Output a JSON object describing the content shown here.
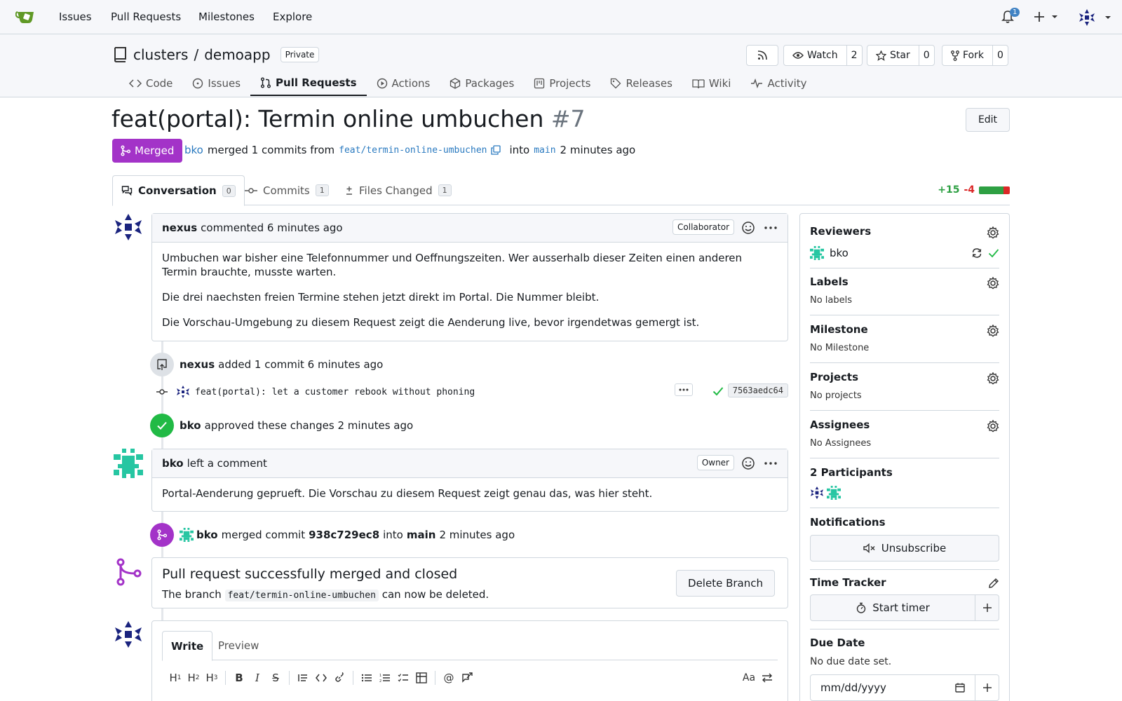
{
  "topnav": {
    "items": [
      "Issues",
      "Pull Requests",
      "Milestones",
      "Explore"
    ],
    "notification_count": "1"
  },
  "repo": {
    "owner": "clusters",
    "separator": "/",
    "name": "demoapp",
    "visibility": "Private",
    "watch_label": "Watch",
    "watch_count": "2",
    "star_label": "Star",
    "star_count": "0",
    "fork_label": "Fork",
    "fork_count": "0",
    "tabs": [
      "Code",
      "Issues",
      "Pull Requests",
      "Actions",
      "Packages",
      "Projects",
      "Releases",
      "Wiki",
      "Activity"
    ]
  },
  "pr": {
    "title": "feat(portal): Termin online umbuchen",
    "number": "#7",
    "edit_label": "Edit",
    "status": "Merged",
    "merger": "bko",
    "merged_text": "merged 1 commits from",
    "head_branch": "feat/termin-online-umbuchen",
    "into_text": "into",
    "base_branch": "main",
    "when": "2 minutes ago",
    "tabs": [
      {
        "label": "Conversation",
        "count": "0"
      },
      {
        "label": "Commits",
        "count": "1"
      },
      {
        "label": "Files Changed",
        "count": "1"
      }
    ],
    "additions": "+15",
    "deletions": "-4"
  },
  "timeline": {
    "comment1": {
      "author": "nexus",
      "action": "commented 6 minutes ago",
      "role": "Collaborator",
      "paragraphs": [
        "Umbuchen war bisher eine Telefonnummer und Oeffnungszeiten. Wer ausserhalb dieser Zeiten einen anderen Termin brauchte, musste warten.",
        "Die drei naechsten freien Termine stehen jetzt direkt im Portal. Die Nummer bleibt.",
        "Die Vorschau-Umgebung zu diesem Request zeigt die Aenderung live, bevor irgendetwas gemergt ist."
      ]
    },
    "commit_event": {
      "author": "nexus",
      "text": "added 1 commit 6 minutes ago"
    },
    "commit": {
      "message": "feat(portal): let a customer rebook without phoning",
      "sha": "7563aedc64"
    },
    "approval": {
      "author": "bko",
      "text": "approved these changes 2 minutes ago"
    },
    "comment2": {
      "author": "bko",
      "action": "left a comment",
      "role": "Owner",
      "body": "Portal-Aenderung geprueft. Die Vorschau zu diesem Request zeigt genau das, was hier steht."
    },
    "merge_event": {
      "author": "bko",
      "text1": "merged commit",
      "sha": "938c729ec8",
      "text2": "into",
      "branch": "main",
      "when": "2 minutes ago"
    },
    "merge_box": {
      "title": "Pull request successfully merged and closed",
      "pre": "The branch",
      "branch": "feat/termin-online-umbuchen",
      "post": "can now be deleted.",
      "button": "Delete Branch"
    },
    "editor": {
      "tab_write": "Write",
      "tab_preview": "Preview",
      "aa": "Aa"
    }
  },
  "sidebar": {
    "reviewers": {
      "title": "Reviewers",
      "name": "bko"
    },
    "labels": {
      "title": "Labels",
      "value": "No labels"
    },
    "milestone": {
      "title": "Milestone",
      "value": "No Milestone"
    },
    "projects": {
      "title": "Projects",
      "value": "No projects"
    },
    "assignees": {
      "title": "Assignees",
      "value": "No Assignees"
    },
    "participants": {
      "title": "2 Participants"
    },
    "notifications": {
      "title": "Notifications",
      "button": "Unsubscribe"
    },
    "time_tracker": {
      "title": "Time Tracker",
      "button": "Start timer"
    },
    "due_date": {
      "title": "Due Date",
      "value": "No due date set.",
      "placeholder": "mm/dd/yyyy"
    }
  },
  "colors": {
    "merged": "#a333c8",
    "approved": "#21ba45",
    "additions": "#2ea043",
    "deletions": "#db2828"
  }
}
